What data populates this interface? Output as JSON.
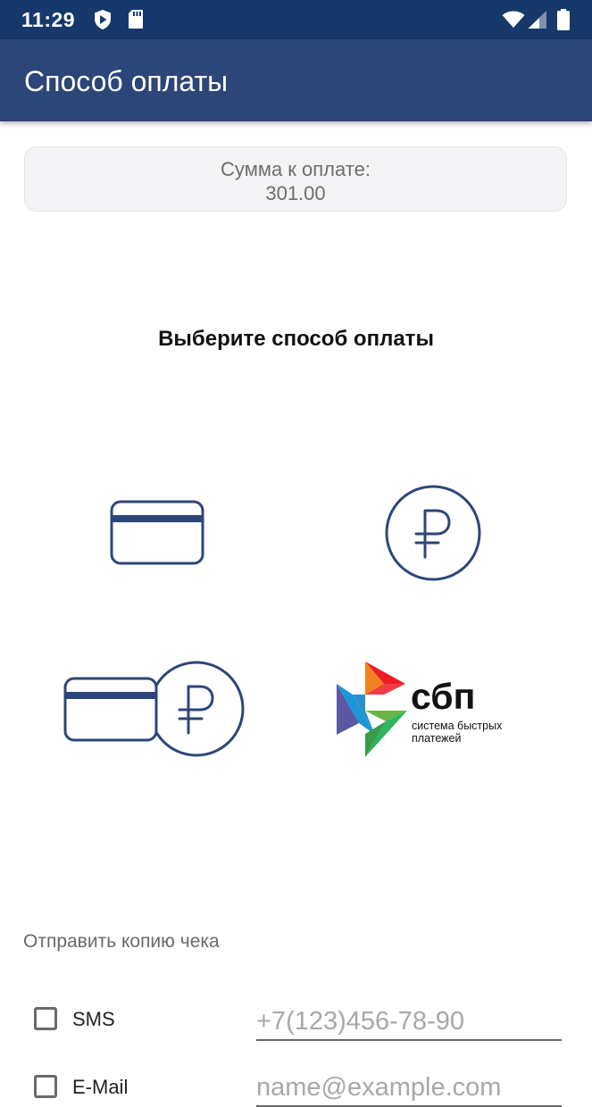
{
  "status_bar": {
    "time": "11:29",
    "icons": [
      "shield-icon",
      "sd-card-icon",
      "wifi-icon",
      "signal-icon",
      "battery-icon"
    ]
  },
  "app_bar": {
    "title": "Способ оплаты"
  },
  "amount": {
    "label": "Сумма к оплате:",
    "value": "301.00"
  },
  "choose_heading": "Выберите способ оплаты",
  "payment_methods": [
    {
      "id": "card",
      "icon": "credit-card-icon"
    },
    {
      "id": "cash",
      "icon": "ruble-icon"
    },
    {
      "id": "mixed",
      "icon": "card-and-ruble-icon"
    },
    {
      "id": "sbp",
      "icon": "sbp-logo",
      "logo_text": "сбп",
      "logo_subtitle_line1": "система быстрых",
      "logo_subtitle_line2": "платежей"
    }
  ],
  "receipt": {
    "label": "Отправить копию чека",
    "sms": {
      "label": "SMS",
      "placeholder": "+7(123)456-78-90",
      "checked": false
    },
    "email": {
      "label": "E-Mail",
      "placeholder": "name@example.com",
      "checked": false
    }
  },
  "colors": {
    "status_bar": "#16386b",
    "app_bar": "#2d4679",
    "icon_stroke": "#2d4679"
  }
}
